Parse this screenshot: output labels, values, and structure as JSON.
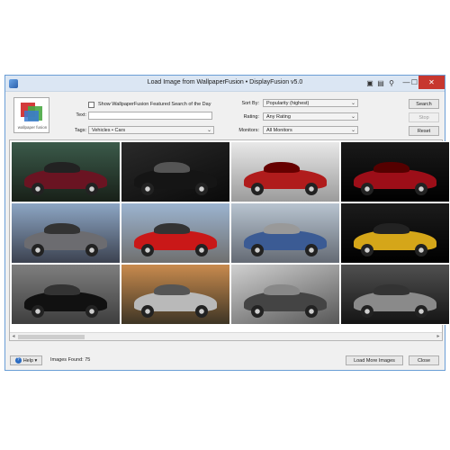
{
  "window": {
    "title": "Load Image from WallpaperFusion • DisplayFusion v5.0",
    "title_buttons": [
      "▣",
      "▤",
      "⚲",
      "✕"
    ],
    "controls": {
      "minimize": "—",
      "maximize": "☐",
      "close": "✕"
    }
  },
  "logo": {
    "text": "wallpaper fusion"
  },
  "featured": {
    "label": "Show WallpaperFusion Featured Search of the Day",
    "checked": false
  },
  "search": {
    "text_label": "Text:",
    "text_value": "",
    "tags_label": "Tags:",
    "tags_value": "Vehicles • Cars",
    "sort_label": "Sort By:",
    "sort_value": "Popularity (highest)",
    "rating_label": "Rating:",
    "rating_value": "Any Rating",
    "monitors_label": "Monitors:",
    "monitors_value": "All Monitors"
  },
  "buttons": {
    "search": "Search",
    "stop": "Stop",
    "reset": "Reset",
    "help": "Help",
    "load_more": "Load More Images",
    "close": "Close"
  },
  "status": {
    "images_found": "Images Found: 75"
  },
  "colors": {
    "accent": "#6a9ed6",
    "close": "#c7372f"
  },
  "thumbnails": [
    {
      "name": "bugatti-veyron-red-black",
      "bg": "linear-gradient(180deg,#3b5a4a,#182018)",
      "car": "#6a1422",
      "roof": "#222"
    },
    {
      "name": "black-car-headlight-closeup",
      "bg": "linear-gradient(160deg,#2a2a2a,#0a0a0a)",
      "car": "#151515",
      "roof": "#555"
    },
    {
      "name": "red-sports-car-studio",
      "bg": "linear-gradient(180deg,#e8e8e8,#9b9b9b)",
      "car": "#b01c1c",
      "roof": "#600"
    },
    {
      "name": "red-ferrari-dark",
      "bg": "linear-gradient(180deg,#1a1a1a,#000)",
      "car": "#9c0e18",
      "roof": "#500"
    },
    {
      "name": "aston-martin-grey",
      "bg": "linear-gradient(180deg,#8da6c4,#3c4250)",
      "car": "#6c6c70",
      "roof": "#333"
    },
    {
      "name": "lotus-red-road",
      "bg": "linear-gradient(180deg,#9cb4d0,#6f6f6f)",
      "car": "#c91818",
      "roof": "#333"
    },
    {
      "name": "bugatti-blue-silver",
      "bg": "linear-gradient(180deg,#b8c4d0,#646a74)",
      "car": "#3b5b94",
      "roof": "#999"
    },
    {
      "name": "yellow-sports-car-rear",
      "bg": "linear-gradient(180deg,#1c1c1c,#000)",
      "car": "#d5a619",
      "roof": "#222"
    },
    {
      "name": "black-sports-car-road-bw",
      "bg": "linear-gradient(180deg,#7e7e7e,#3e3e3e)",
      "car": "#111",
      "roof": "#333"
    },
    {
      "name": "porsche-silver-sunset",
      "bg": "linear-gradient(180deg,#c98b4e,#3e3525)",
      "car": "#b9b9b9",
      "roof": "#555"
    },
    {
      "name": "car-detail-plate",
      "bg": "linear-gradient(160deg,#d0d0d0,#575757)",
      "car": "#444",
      "roof": "#888"
    },
    {
      "name": "silver-concept-car",
      "bg": "linear-gradient(180deg,#505050,#141414)",
      "car": "#8a8a8a",
      "roof": "#333"
    }
  ]
}
